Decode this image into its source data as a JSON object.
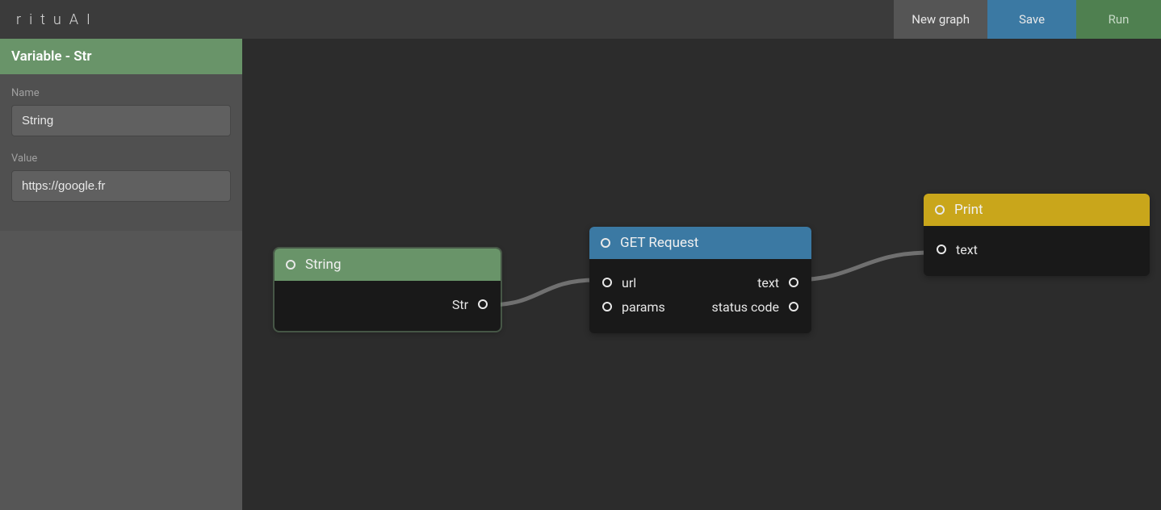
{
  "app": {
    "logo": "rituAI"
  },
  "topbar": {
    "newgraph": "New graph",
    "save": "Save",
    "run": "Run"
  },
  "sidebar": {
    "header": "Variable - Str",
    "name_label": "Name",
    "name_value": "String",
    "value_label": "Value",
    "value_value": "https://google.fr"
  },
  "nodes": {
    "string": {
      "title": "String",
      "out_str": "Str"
    },
    "get": {
      "title": "GET Request",
      "in_url": "url",
      "in_params": "params",
      "out_text": "text",
      "out_status": "status code"
    },
    "print": {
      "title": "Print",
      "in_text": "text"
    }
  }
}
